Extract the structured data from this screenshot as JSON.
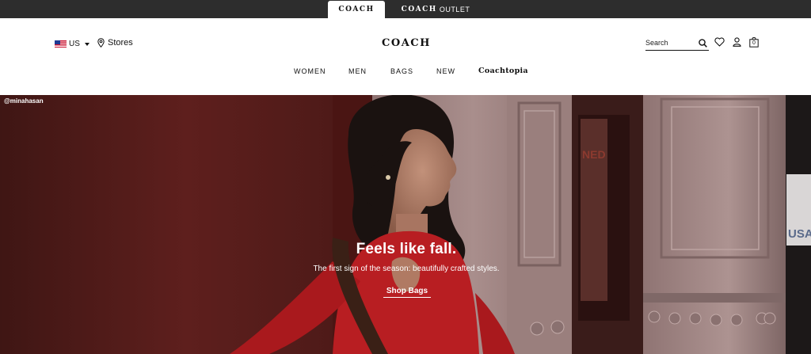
{
  "brandbar": {
    "coach_tab": {
      "logo": "COACH"
    },
    "outlet_tab": {
      "logo": "COACH",
      "suffix": "OUTLET"
    }
  },
  "header": {
    "locale": {
      "flag": "us-flag-icon",
      "label": "US"
    },
    "stores": {
      "label": "Stores"
    },
    "logo": "COACH",
    "search": {
      "placeholder": "Search",
      "value": ""
    },
    "bag_count": "0"
  },
  "nav": {
    "items": [
      "WOMEN",
      "MEN",
      "BAGS",
      "NEW",
      "Coachtopia"
    ]
  },
  "hero": {
    "credit": "@minahasan",
    "headline": "Feels like fall.",
    "subline": "The first sign of the season: beautifully crafted styles.",
    "cta": "Shop Bags"
  },
  "colors": {
    "topbar": "#2d2d2d",
    "text": "#111111",
    "hero_wall": "#5a1e1c",
    "hero_pillar": "#a08583",
    "sweater": "#b81e22"
  }
}
